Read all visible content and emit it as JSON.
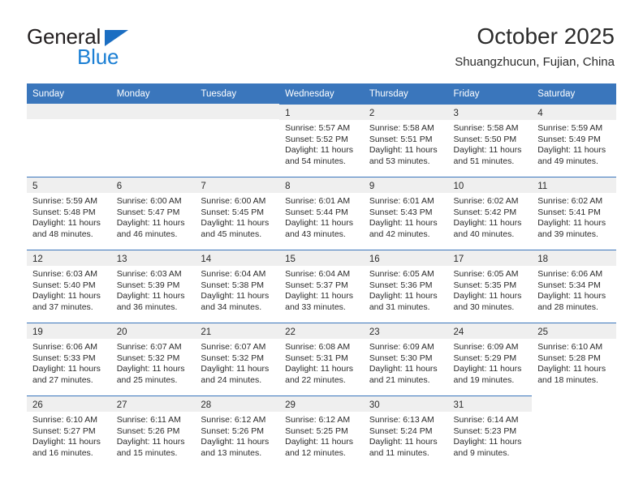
{
  "brand": {
    "name_top": "General",
    "name_bottom": "Blue"
  },
  "header": {
    "title": "October 2025",
    "subtitle": "Shuangzhucun, Fujian, China"
  },
  "colors": {
    "header_blue": "#3a76bc",
    "brand_blue": "#1b7fd4",
    "day_band_gray": "#efefef",
    "text": "#2b2b2b"
  },
  "weekday_headers": [
    "Sunday",
    "Monday",
    "Tuesday",
    "Wednesday",
    "Thursday",
    "Friday",
    "Saturday"
  ],
  "weeks": [
    [
      {
        "day": "",
        "blank": true,
        "empty": true,
        "sunrise": "",
        "sunset": "",
        "daylight1": "",
        "daylight2": ""
      },
      {
        "day": "",
        "blank": true,
        "empty": true,
        "sunrise": "",
        "sunset": "",
        "daylight1": "",
        "daylight2": ""
      },
      {
        "day": "",
        "blank": true,
        "empty": true,
        "sunrise": "",
        "sunset": "",
        "daylight1": "",
        "daylight2": ""
      },
      {
        "day": "1",
        "sunrise": "Sunrise: 5:57 AM",
        "sunset": "Sunset: 5:52 PM",
        "daylight1": "Daylight: 11 hours",
        "daylight2": "and 54 minutes."
      },
      {
        "day": "2",
        "sunrise": "Sunrise: 5:58 AM",
        "sunset": "Sunset: 5:51 PM",
        "daylight1": "Daylight: 11 hours",
        "daylight2": "and 53 minutes."
      },
      {
        "day": "3",
        "sunrise": "Sunrise: 5:58 AM",
        "sunset": "Sunset: 5:50 PM",
        "daylight1": "Daylight: 11 hours",
        "daylight2": "and 51 minutes."
      },
      {
        "day": "4",
        "sunrise": "Sunrise: 5:59 AM",
        "sunset": "Sunset: 5:49 PM",
        "daylight1": "Daylight: 11 hours",
        "daylight2": "and 49 minutes."
      }
    ],
    [
      {
        "day": "5",
        "sunrise": "Sunrise: 5:59 AM",
        "sunset": "Sunset: 5:48 PM",
        "daylight1": "Daylight: 11 hours",
        "daylight2": "and 48 minutes."
      },
      {
        "day": "6",
        "sunrise": "Sunrise: 6:00 AM",
        "sunset": "Sunset: 5:47 PM",
        "daylight1": "Daylight: 11 hours",
        "daylight2": "and 46 minutes."
      },
      {
        "day": "7",
        "sunrise": "Sunrise: 6:00 AM",
        "sunset": "Sunset: 5:45 PM",
        "daylight1": "Daylight: 11 hours",
        "daylight2": "and 45 minutes."
      },
      {
        "day": "8",
        "sunrise": "Sunrise: 6:01 AM",
        "sunset": "Sunset: 5:44 PM",
        "daylight1": "Daylight: 11 hours",
        "daylight2": "and 43 minutes."
      },
      {
        "day": "9",
        "sunrise": "Sunrise: 6:01 AM",
        "sunset": "Sunset: 5:43 PM",
        "daylight1": "Daylight: 11 hours",
        "daylight2": "and 42 minutes."
      },
      {
        "day": "10",
        "sunrise": "Sunrise: 6:02 AM",
        "sunset": "Sunset: 5:42 PM",
        "daylight1": "Daylight: 11 hours",
        "daylight2": "and 40 minutes."
      },
      {
        "day": "11",
        "sunrise": "Sunrise: 6:02 AM",
        "sunset": "Sunset: 5:41 PM",
        "daylight1": "Daylight: 11 hours",
        "daylight2": "and 39 minutes."
      }
    ],
    [
      {
        "day": "12",
        "sunrise": "Sunrise: 6:03 AM",
        "sunset": "Sunset: 5:40 PM",
        "daylight1": "Daylight: 11 hours",
        "daylight2": "and 37 minutes."
      },
      {
        "day": "13",
        "sunrise": "Sunrise: 6:03 AM",
        "sunset": "Sunset: 5:39 PM",
        "daylight1": "Daylight: 11 hours",
        "daylight2": "and 36 minutes."
      },
      {
        "day": "14",
        "sunrise": "Sunrise: 6:04 AM",
        "sunset": "Sunset: 5:38 PM",
        "daylight1": "Daylight: 11 hours",
        "daylight2": "and 34 minutes."
      },
      {
        "day": "15",
        "sunrise": "Sunrise: 6:04 AM",
        "sunset": "Sunset: 5:37 PM",
        "daylight1": "Daylight: 11 hours",
        "daylight2": "and 33 minutes."
      },
      {
        "day": "16",
        "sunrise": "Sunrise: 6:05 AM",
        "sunset": "Sunset: 5:36 PM",
        "daylight1": "Daylight: 11 hours",
        "daylight2": "and 31 minutes."
      },
      {
        "day": "17",
        "sunrise": "Sunrise: 6:05 AM",
        "sunset": "Sunset: 5:35 PM",
        "daylight1": "Daylight: 11 hours",
        "daylight2": "and 30 minutes."
      },
      {
        "day": "18",
        "sunrise": "Sunrise: 6:06 AM",
        "sunset": "Sunset: 5:34 PM",
        "daylight1": "Daylight: 11 hours",
        "daylight2": "and 28 minutes."
      }
    ],
    [
      {
        "day": "19",
        "sunrise": "Sunrise: 6:06 AM",
        "sunset": "Sunset: 5:33 PM",
        "daylight1": "Daylight: 11 hours",
        "daylight2": "and 27 minutes."
      },
      {
        "day": "20",
        "sunrise": "Sunrise: 6:07 AM",
        "sunset": "Sunset: 5:32 PM",
        "daylight1": "Daylight: 11 hours",
        "daylight2": "and 25 minutes."
      },
      {
        "day": "21",
        "sunrise": "Sunrise: 6:07 AM",
        "sunset": "Sunset: 5:32 PM",
        "daylight1": "Daylight: 11 hours",
        "daylight2": "and 24 minutes."
      },
      {
        "day": "22",
        "sunrise": "Sunrise: 6:08 AM",
        "sunset": "Sunset: 5:31 PM",
        "daylight1": "Daylight: 11 hours",
        "daylight2": "and 22 minutes."
      },
      {
        "day": "23",
        "sunrise": "Sunrise: 6:09 AM",
        "sunset": "Sunset: 5:30 PM",
        "daylight1": "Daylight: 11 hours",
        "daylight2": "and 21 minutes."
      },
      {
        "day": "24",
        "sunrise": "Sunrise: 6:09 AM",
        "sunset": "Sunset: 5:29 PM",
        "daylight1": "Daylight: 11 hours",
        "daylight2": "and 19 minutes."
      },
      {
        "day": "25",
        "sunrise": "Sunrise: 6:10 AM",
        "sunset": "Sunset: 5:28 PM",
        "daylight1": "Daylight: 11 hours",
        "daylight2": "and 18 minutes."
      }
    ],
    [
      {
        "day": "26",
        "sunrise": "Sunrise: 6:10 AM",
        "sunset": "Sunset: 5:27 PM",
        "daylight1": "Daylight: 11 hours",
        "daylight2": "and 16 minutes."
      },
      {
        "day": "27",
        "sunrise": "Sunrise: 6:11 AM",
        "sunset": "Sunset: 5:26 PM",
        "daylight1": "Daylight: 11 hours",
        "daylight2": "and 15 minutes."
      },
      {
        "day": "28",
        "sunrise": "Sunrise: 6:12 AM",
        "sunset": "Sunset: 5:26 PM",
        "daylight1": "Daylight: 11 hours",
        "daylight2": "and 13 minutes."
      },
      {
        "day": "29",
        "sunrise": "Sunrise: 6:12 AM",
        "sunset": "Sunset: 5:25 PM",
        "daylight1": "Daylight: 11 hours",
        "daylight2": "and 12 minutes."
      },
      {
        "day": "30",
        "sunrise": "Sunrise: 6:13 AM",
        "sunset": "Sunset: 5:24 PM",
        "daylight1": "Daylight: 11 hours",
        "daylight2": "and 11 minutes."
      },
      {
        "day": "31",
        "sunrise": "Sunrise: 6:14 AM",
        "sunset": "Sunset: 5:23 PM",
        "daylight1": "Daylight: 11 hours",
        "daylight2": "and 9 minutes."
      },
      {
        "day": "",
        "blank": true,
        "fully_blank": true,
        "sunrise": "",
        "sunset": "",
        "daylight1": "",
        "daylight2": ""
      }
    ]
  ]
}
